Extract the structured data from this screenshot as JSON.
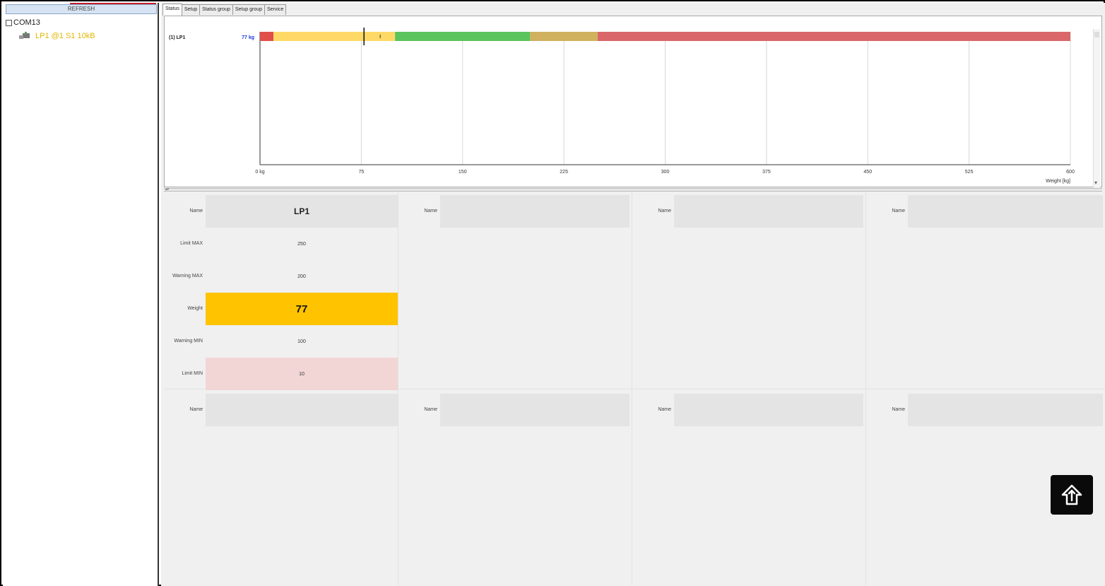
{
  "left_panel": {
    "refresh_label": "REFRESH",
    "tree_root": "COM13",
    "device_item": "LP1 @1 S1 10kB"
  },
  "tabs": [
    "Status",
    "Setup",
    "Status group",
    "Setup group",
    "Service"
  ],
  "chart_data": {
    "type": "bar",
    "orientation": "horizontal",
    "title": "",
    "series_label": "(1) LP1",
    "value_label": "77 kg",
    "value": 77,
    "xlabel": "Weight [kg]",
    "xlim": [
      0,
      600
    ],
    "x_ticks": [
      "0 kg",
      "75",
      "150",
      "225",
      "300",
      "375",
      "450",
      "525",
      "600"
    ],
    "tick_values": [
      0,
      75,
      150,
      225,
      300,
      375,
      450,
      525,
      600
    ],
    "zones": [
      {
        "from": 0,
        "to": 10,
        "color": "#e0504a"
      },
      {
        "from": 10,
        "to": 100,
        "color": "#ffd966"
      },
      {
        "from": 100,
        "to": 200,
        "color": "#5cc45c"
      },
      {
        "from": 200,
        "to": 250,
        "color": "#cfb15e"
      },
      {
        "from": 250,
        "to": 600,
        "color": "#d9676a"
      }
    ],
    "markers": [
      77,
      89
    ],
    "grid": true
  },
  "panels": {
    "label_name": "Name",
    "label_limit_max": "Limit MAX",
    "label_warning_max": "Warning MAX",
    "label_weight": "Weight",
    "label_warning_min": "Warning MIN",
    "label_limit_min": "Limit MIN",
    "lp1_name": "LP1",
    "lp1_limit_max": "250",
    "lp1_warning_max": "200",
    "lp1_weight": "77",
    "lp1_warning_min": "100",
    "lp1_limit_min": "10"
  },
  "colors": {
    "weight_bg": "#ffc300",
    "limit_min_bg": "#f2d5d5",
    "accent_blue": "#1a37d8",
    "device_text": "#e3b600"
  },
  "home_button_icon": "home-arrow-icon"
}
